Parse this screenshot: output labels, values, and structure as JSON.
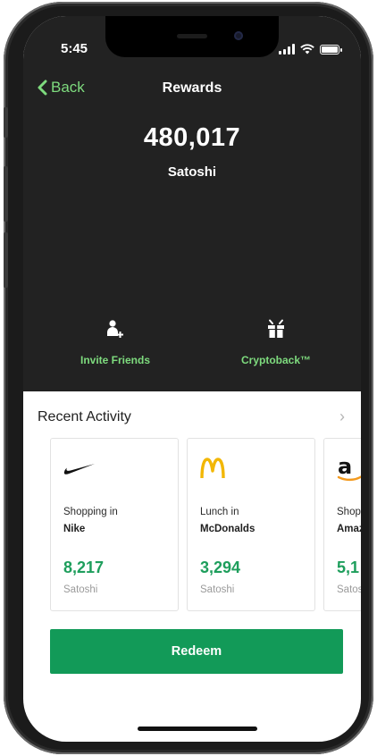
{
  "status_bar": {
    "time": "5:45"
  },
  "nav": {
    "back_label": "Back",
    "title": "Rewards"
  },
  "balance": {
    "amount": "480,017",
    "unit": "Satoshi"
  },
  "actions": [
    {
      "label": "Invite Friends",
      "icon": "add-person-icon"
    },
    {
      "label": "Cryptoback™",
      "icon": "gift-icon"
    }
  ],
  "recent": {
    "title": "Recent Activity",
    "cards": [
      {
        "logo": "nike-swoosh-logo",
        "desc": "Shopping in",
        "merchant": "Nike",
        "amount": "8,217",
        "unit": "Satoshi"
      },
      {
        "logo": "mcdonalds-arches-logo",
        "desc": "Lunch in",
        "merchant": "McDonalds",
        "amount": "3,294",
        "unit": "Satoshi"
      },
      {
        "logo": "amazon-logo",
        "desc": "Shopping in",
        "merchant": "Amazon",
        "amount": "5,1",
        "unit": "Satoshi"
      }
    ]
  },
  "redeem": {
    "label": "Redeem"
  },
  "colors": {
    "accent_green": "#7edb7e",
    "primary_green": "#129a58",
    "amount_green": "#1e9e5c",
    "header_bg": "#222222"
  }
}
